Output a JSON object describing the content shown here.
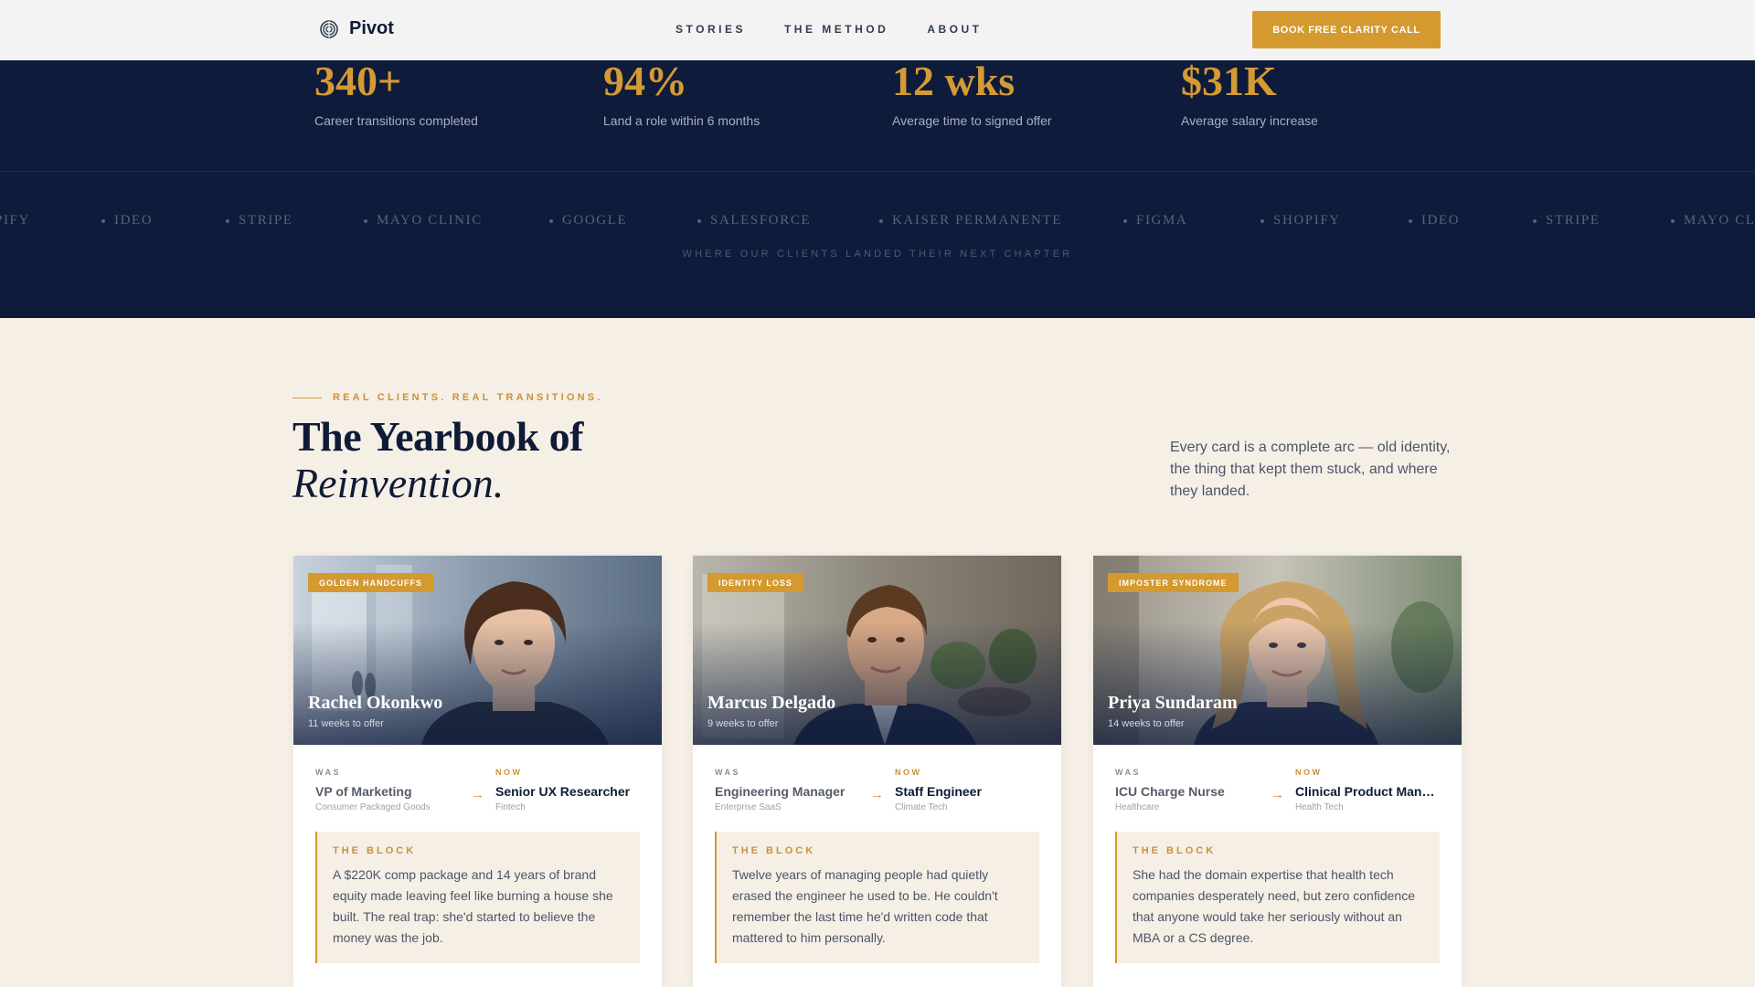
{
  "nav": {
    "brand": "Pivot",
    "links": [
      "STORIES",
      "THE METHOD",
      "ABOUT"
    ],
    "cta": "BOOK FREE CLARITY CALL"
  },
  "stats": [
    {
      "value": "340+",
      "label": "Career transitions completed"
    },
    {
      "value": "94%",
      "label": "Land a role within 6 months"
    },
    {
      "value": "12 wks",
      "label": "Average time to signed offer"
    },
    {
      "value": "$31K",
      "label": "Average salary increase"
    }
  ],
  "logos": [
    "PIFY",
    "IDEO",
    "STRIPE",
    "MAYO CLINIC",
    "GOOGLE",
    "SALESFORCE",
    "KAISER PERMANENTE",
    "FIGMA",
    "SHOPIFY",
    "IDEO",
    "STRIPE",
    "MAYO CLI"
  ],
  "band_caption": "WHERE OUR CLIENTS LANDED THEIR NEXT CHAPTER",
  "section": {
    "eyebrow": "REAL CLIENTS. REAL TRANSITIONS.",
    "heading_line1": "The Yearbook of",
    "heading_line2": "Reinvention.",
    "intro": "Every card is a complete arc — old identity, the thing that kept them stuck, and where they landed."
  },
  "labels": {
    "was": "WAS",
    "now": "NOW",
    "block": "THE BLOCK"
  },
  "cards": [
    {
      "tag": "GOLDEN HANDCUFFS",
      "name": "Rachel Okonkwo",
      "weeks": "11 weeks to offer",
      "was_role": "VP of Marketing",
      "was_industry": "Consumer Packaged Goods",
      "now_role": "Senior UX Researcher",
      "now_industry": "Fintech",
      "block": "A $220K comp package and 14 years of brand equity made leaving feel like burning a house she built. The real trap: she'd started to believe the money was the job.",
      "hair": "#4a2d1c",
      "skin": "#e9c2a6"
    },
    {
      "tag": "IDENTITY LOSS",
      "name": "Marcus Delgado",
      "weeks": "9 weeks to offer",
      "was_role": "Engineering Manager",
      "was_industry": "Enterprise SaaS",
      "now_role": "Staff Engineer",
      "now_industry": "Climate Tech",
      "block": "Twelve years of managing people had quietly erased the engineer he used to be. He couldn't remember the last time he'd written code that mattered to him personally.",
      "hair": "#5a3b22",
      "skin": "#d9a886"
    },
    {
      "tag": "IMPOSTER SYNDROME",
      "name": "Priya Sundaram",
      "weeks": "14 weeks to offer",
      "was_role": "ICU Charge Nurse",
      "was_industry": "Healthcare",
      "now_role": "Clinical Product Man…",
      "now_industry": "Health Tech",
      "block": "She had the domain expertise that health tech companies desperately need, but zero confidence that anyone would take her seriously without an MBA or a CS degree.",
      "hair": "#c9a265",
      "skin": "#edc8ad"
    }
  ]
}
